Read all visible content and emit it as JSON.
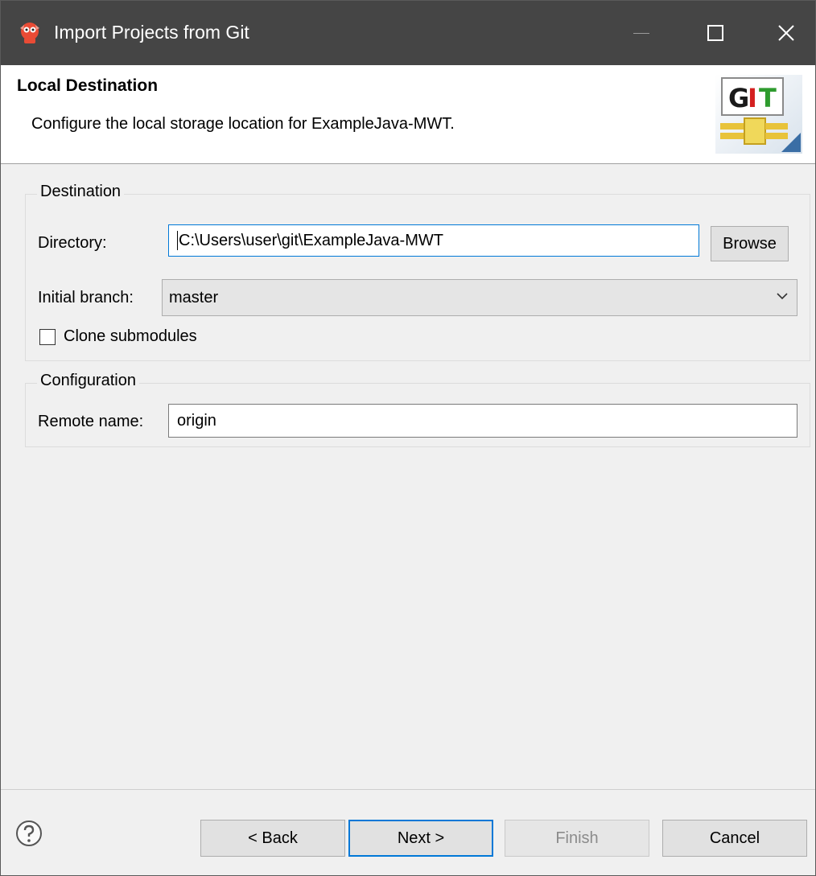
{
  "window": {
    "title": "Import Projects from Git",
    "controls": {
      "minimize": "minimize-icon",
      "maximize": "maximize-icon",
      "close": "close-icon"
    }
  },
  "banner": {
    "title": "Local Destination",
    "description": "Configure the local storage location for ExampleJava-MWT.",
    "logo_text_g": "G",
    "logo_text_i": "I",
    "logo_text_t": "T"
  },
  "destination": {
    "group_label": "Destination",
    "directory_label": "Directory:",
    "directory_value": "C:\\Users\\user\\git\\ExampleJava-MWT",
    "browse_label": "Browse",
    "branch_label": "Initial branch:",
    "branch_value": "master",
    "clone_submodules_label": "Clone submodules",
    "clone_submodules_checked": false
  },
  "configuration": {
    "group_label": "Configuration",
    "remote_name_label": "Remote name:",
    "remote_name_value": "origin"
  },
  "footer": {
    "back_label": "< Back",
    "next_label": "Next >",
    "finish_label": "Finish",
    "cancel_label": "Cancel"
  },
  "colors": {
    "titlebar": "#454545",
    "accent": "#0078d7",
    "logo_green": "#2e9b2e",
    "logo_red": "#d42020"
  }
}
